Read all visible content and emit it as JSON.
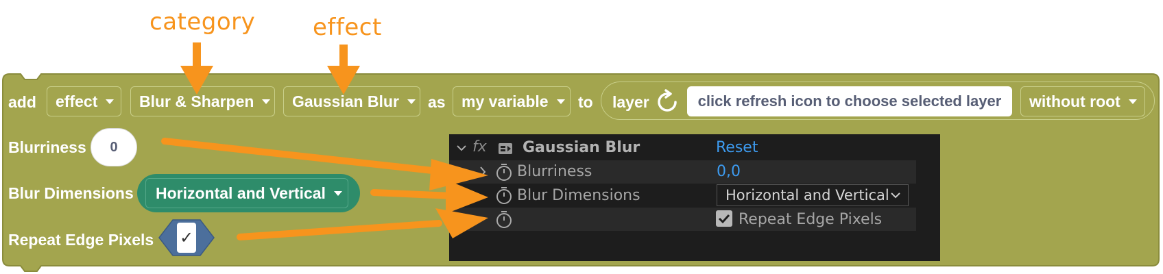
{
  "annotations": {
    "category": "category",
    "effect": "effect"
  },
  "block": {
    "add_label": "add",
    "effect_dd": "effect",
    "category_dd": "Blur & Sharpen",
    "effect_name_dd": "Gaussian Blur",
    "as_label": "as",
    "variable_dd": "my variable",
    "to_label": "to",
    "layer_label": "layer",
    "layer_input": "click refresh icon to choose selected layer",
    "root_dd": "without root",
    "blurriness_label": "Blurriness",
    "blurriness_value": "0",
    "blur_dimensions_label": "Blur Dimensions",
    "blur_dimensions_value": "Horizontal and Vertical",
    "repeat_edge_label": "Repeat Edge Pixels",
    "repeat_edge_checked": "✓"
  },
  "ae_panel": {
    "fx": "fx",
    "effect_name": "Gaussian Blur",
    "reset": "Reset",
    "blurriness_label": "Blurriness",
    "blurriness_value": "0,0",
    "blur_dimensions_label": "Blur Dimensions",
    "blur_dimensions_value": "Horizontal and Vertical",
    "repeat_edge_label": "Repeat Edge Pixels"
  },
  "colors": {
    "block": "#a3a54e",
    "block_border": "#8a8c3c",
    "annotation": "#f7941d",
    "green": "#2e8c6a",
    "hex_blue": "#4c6f9c",
    "ae_bg": "#1d1d1d",
    "ae_blue": "#3d9bf0"
  }
}
